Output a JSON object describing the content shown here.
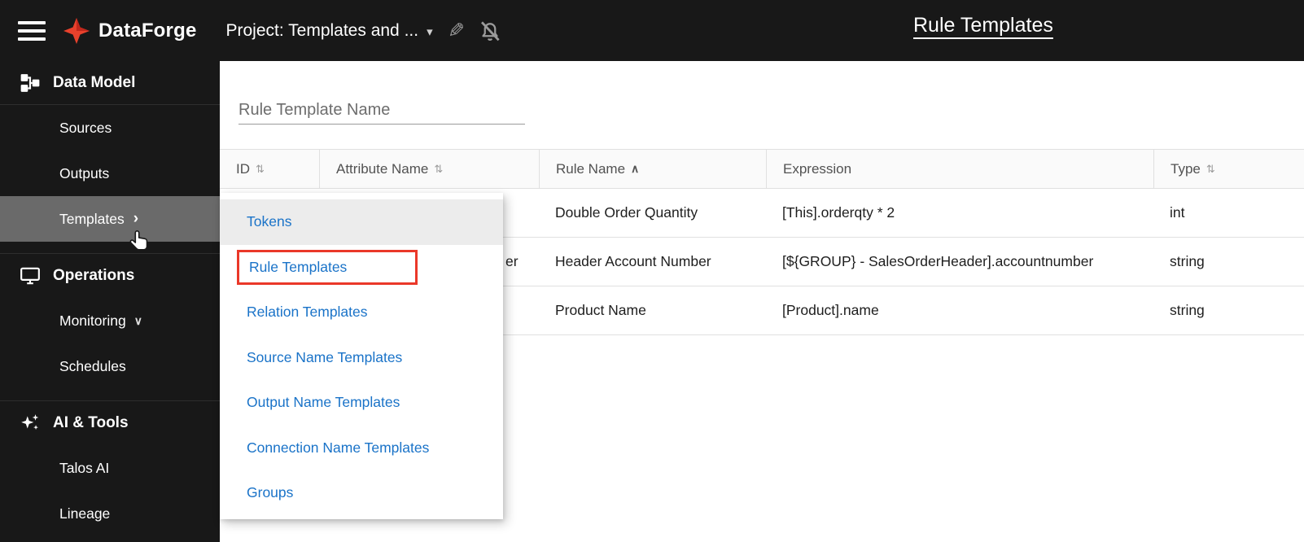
{
  "topbar": {
    "brand": "DataForge",
    "project_label": "Project: Templates and ...",
    "page_title": "Rule Templates"
  },
  "icons": {
    "caret_down": "▾",
    "pencil": "✎",
    "chevron_right": "›",
    "chevron_down": "∨",
    "sort_both": "⇅",
    "sort_asc": "∧"
  },
  "sidebar": {
    "sections": [
      {
        "label": "Data Model",
        "icon": "data-model-icon",
        "items": [
          {
            "label": "Sources"
          },
          {
            "label": "Outputs"
          },
          {
            "label": "Templates",
            "selected": true
          }
        ]
      },
      {
        "label": "Operations",
        "icon": "monitor-icon",
        "items": [
          {
            "label": "Monitoring",
            "expandable": true
          },
          {
            "label": "Schedules"
          }
        ]
      },
      {
        "label": "AI & Tools",
        "icon": "sparkles-icon",
        "items": [
          {
            "label": "Talos AI"
          },
          {
            "label": "Lineage"
          }
        ]
      }
    ]
  },
  "search": {
    "placeholder": "Rule Template Name"
  },
  "table": {
    "columns": [
      {
        "label": "ID",
        "sort": "both"
      },
      {
        "label": "Attribute Name",
        "sort": "both"
      },
      {
        "label": "Rule Name",
        "sort": "asc"
      },
      {
        "label": "Expression",
        "sort": "none"
      },
      {
        "label": "Type",
        "sort": "both"
      }
    ],
    "rows": [
      {
        "rule_name": "Double Order Quantity",
        "expression": "[This].orderqty * 2",
        "type": "int"
      },
      {
        "attribute_name_fragment": "er",
        "rule_name": "Header Account Number",
        "expression": "[${GROUP} - SalesOrderHeader].accountnumber",
        "type": "string"
      },
      {
        "rule_name": "Product Name",
        "expression": "[Product].name",
        "type": "string"
      }
    ]
  },
  "submenu": {
    "items": [
      {
        "label": "Tokens",
        "state": "hovered"
      },
      {
        "label": "Rule Templates",
        "state": "highlighted-red"
      },
      {
        "label": "Relation Templates"
      },
      {
        "label": "Source Name Templates"
      },
      {
        "label": "Output Name Templates"
      },
      {
        "label": "Connection Name Templates"
      },
      {
        "label": "Groups"
      }
    ]
  },
  "colors": {
    "accent_red": "#e8412c",
    "link_blue": "#1a73c8",
    "topbar_bg": "#181818",
    "selected_gray": "#6a6a6a"
  }
}
